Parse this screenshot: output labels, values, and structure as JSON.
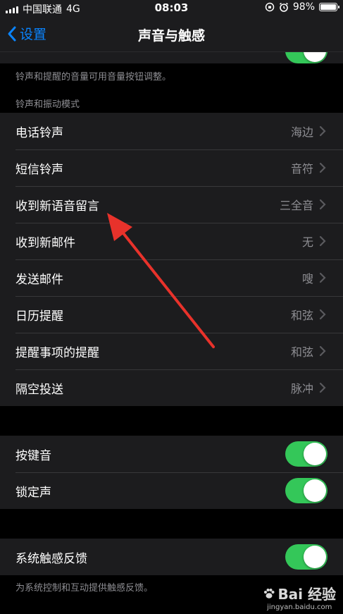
{
  "status_bar": {
    "carrier": "中国联通",
    "network": "4G",
    "time": "08:03",
    "battery_percent": "98%",
    "battery_level": 0.98
  },
  "nav": {
    "back_label": "设置",
    "title": "声音与触感"
  },
  "volume_note": "铃声和提醒的音量可用音量按钮调整。",
  "ringtone_section": {
    "header": "铃声和振动模式",
    "items": [
      {
        "label": "电话铃声",
        "value": "海边"
      },
      {
        "label": "短信铃声",
        "value": "音符"
      },
      {
        "label": "收到新语音留言",
        "value": "三全音"
      },
      {
        "label": "收到新邮件",
        "value": "无"
      },
      {
        "label": "发送邮件",
        "value": "嗖"
      },
      {
        "label": "日历提醒",
        "value": "和弦"
      },
      {
        "label": "提醒事项的提醒",
        "value": "和弦"
      },
      {
        "label": "隔空投送",
        "value": "脉冲"
      }
    ]
  },
  "toggles_section": {
    "items": [
      {
        "label": "按键音",
        "on": true
      },
      {
        "label": "锁定声",
        "on": true
      }
    ]
  },
  "haptics_section": {
    "label": "系统触感反馈",
    "on": true,
    "footnote": "为系统控制和互动提供触感反馈。"
  },
  "watermark": {
    "brand": "Bai 经验",
    "url": "jingyan.baidu.com"
  },
  "colors": {
    "accent": "#0a84ff",
    "toggle_on": "#34c759",
    "annotation": "#e8322b"
  }
}
